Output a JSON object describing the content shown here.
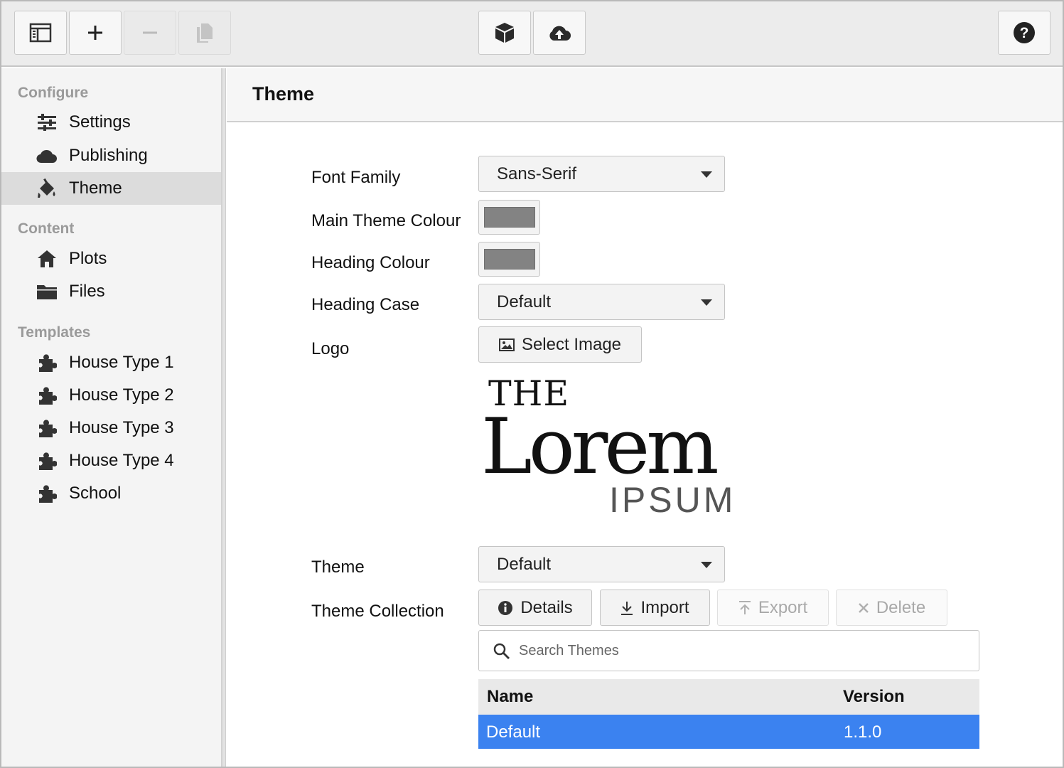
{
  "toolbar": {
    "buttons": [
      {
        "name": "toggle-sidebar",
        "icon": "sidebar-panel-icon",
        "enabled": true
      },
      {
        "name": "add",
        "icon": "plus-icon",
        "enabled": true
      },
      {
        "name": "remove",
        "icon": "minus-icon",
        "enabled": false
      },
      {
        "name": "duplicate",
        "icon": "copy-icon",
        "enabled": false
      },
      {
        "name": "package",
        "icon": "cube-icon",
        "enabled": true
      },
      {
        "name": "upload",
        "icon": "cloud-upload-icon",
        "enabled": true
      },
      {
        "name": "help",
        "icon": "question-circle-icon",
        "enabled": true
      }
    ]
  },
  "sidebar": {
    "configure_heading": "Configure",
    "configure_items": [
      {
        "label": "Settings",
        "icon": "sliders-icon"
      },
      {
        "label": "Publishing",
        "icon": "cloud-icon"
      },
      {
        "label": "Theme",
        "icon": "paint-bucket-icon",
        "active": true
      }
    ],
    "content_heading": "Content",
    "content_items": [
      {
        "label": "Plots",
        "icon": "home-icon"
      },
      {
        "label": "Files",
        "icon": "folder-icon"
      }
    ],
    "templates_heading": "Templates",
    "template_items": [
      {
        "label": "House Type 1",
        "icon": "puzzle-icon"
      },
      {
        "label": "House Type 2",
        "icon": "puzzle-icon"
      },
      {
        "label": "House Type 3",
        "icon": "puzzle-icon"
      },
      {
        "label": "House Type 4",
        "icon": "puzzle-icon"
      },
      {
        "label": "School",
        "icon": "puzzle-icon"
      }
    ]
  },
  "main": {
    "title": "Theme",
    "font_family": {
      "label": "Font Family",
      "value": "Sans-Serif"
    },
    "main_theme_colour": {
      "label": "Main Theme Colour",
      "value": "#838383"
    },
    "heading_colour": {
      "label": "Heading Colour",
      "value": "#838383"
    },
    "heading_case": {
      "label": "Heading Case",
      "value": "Default"
    },
    "logo": {
      "label": "Logo",
      "select_button": "Select Image",
      "line1": "THE",
      "line2": "Lorem",
      "line3": "IPSUM"
    },
    "theme": {
      "label": "Theme",
      "value": "Default"
    },
    "theme_collection": {
      "label": "Theme Collection",
      "details_button": "Details",
      "import_button": "Import",
      "export_button": "Export",
      "delete_button": "Delete",
      "search_placeholder": "Search Themes",
      "columns": [
        "Name",
        "Version"
      ],
      "rows": [
        {
          "name": "Default",
          "version": "1.1.0",
          "selected": true
        }
      ]
    }
  },
  "colors": {
    "selection": "#3b82f0",
    "toolbar_bg": "#ececec",
    "sidebar_bg": "#f4f4f4",
    "active_item_bg": "#dcdcdc"
  }
}
